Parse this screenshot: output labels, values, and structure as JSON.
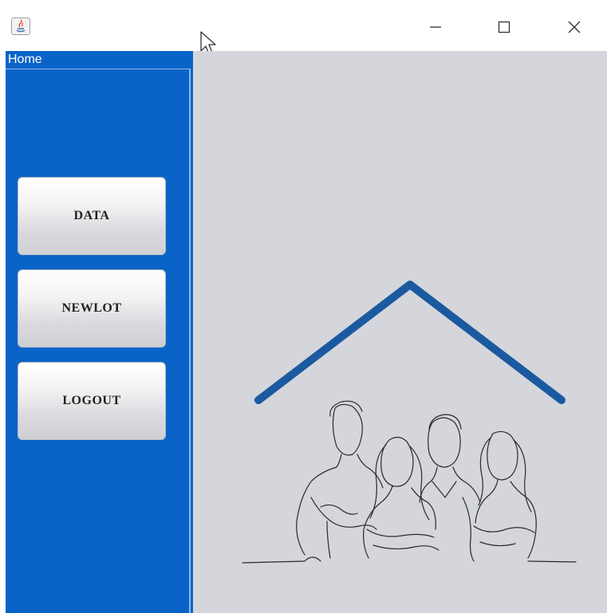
{
  "window": {
    "panel_title": "Home"
  },
  "sidebar": {
    "buttons": [
      {
        "label": "DATA"
      },
      {
        "label": "NEWLOT"
      },
      {
        "label": "LOGOUT"
      }
    ]
  },
  "colors": {
    "sidebar_bg": "#0a64c8",
    "main_bg": "#d4d6dc",
    "roof": "#1b5aa0"
  },
  "icons": {
    "app": "java-icon",
    "minimize": "minimize-icon",
    "maximize": "maximize-icon",
    "close": "close-icon",
    "illustration": "family-house-illustration"
  }
}
